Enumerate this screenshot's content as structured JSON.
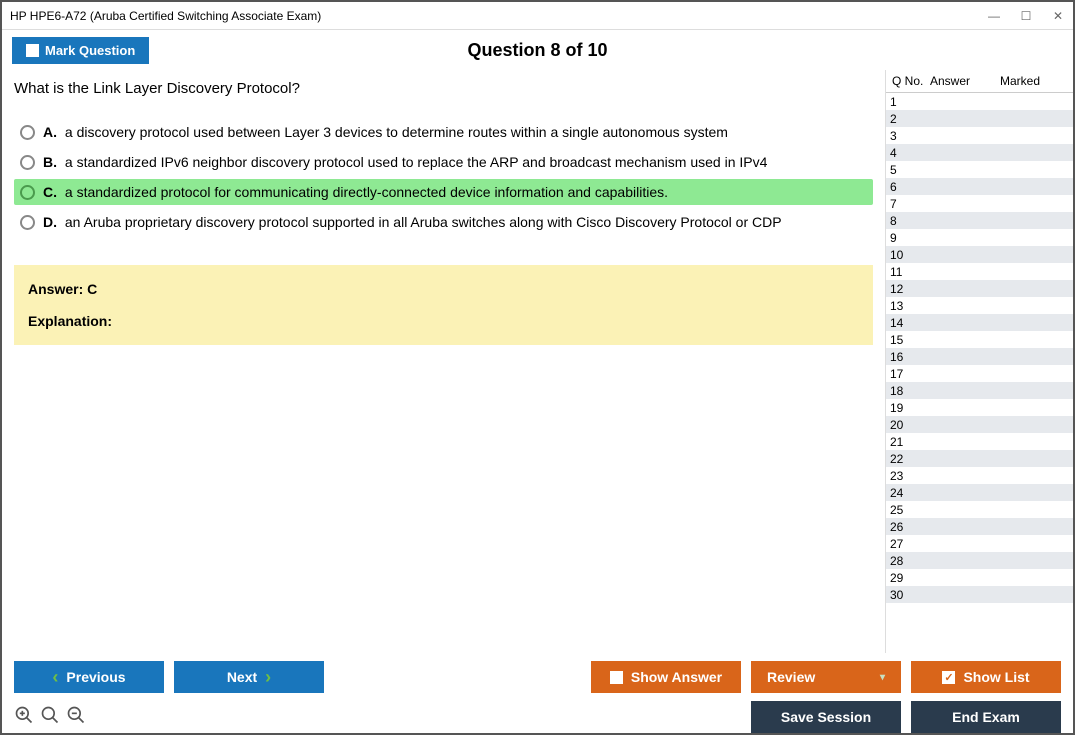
{
  "window": {
    "title": "HP HPE6-A72 (Aruba Certified Switching Associate Exam)"
  },
  "header": {
    "mark_label": "Mark Question",
    "counter": "Question 8 of 10"
  },
  "question": {
    "text": "What is the Link Layer Discovery Protocol?",
    "options": [
      {
        "letter": "A.",
        "text": "a discovery protocol used between Layer 3 devices to determine routes within a single autonomous system",
        "selected": false
      },
      {
        "letter": "B.",
        "text": "a standardized IPv6 neighbor discovery protocol used to replace the ARP and broadcast mechanism used in IPv4",
        "selected": false
      },
      {
        "letter": "C.",
        "text": "a standardized protocol for communicating directly-connected device information and capabilities.",
        "selected": true
      },
      {
        "letter": "D.",
        "text": "an Aruba proprietary discovery protocol supported in all Aruba switches along with Cisco Discovery Protocol or CDP",
        "selected": false
      }
    ]
  },
  "answer": {
    "line": "Answer: C",
    "explanation_label": "Explanation:"
  },
  "sidebar": {
    "col_qno": "Q No.",
    "col_answer": "Answer",
    "col_marked": "Marked",
    "rows": [
      "1",
      "2",
      "3",
      "4",
      "5",
      "6",
      "7",
      "8",
      "9",
      "10",
      "11",
      "12",
      "13",
      "14",
      "15",
      "16",
      "17",
      "18",
      "19",
      "20",
      "21",
      "22",
      "23",
      "24",
      "25",
      "26",
      "27",
      "28",
      "29",
      "30"
    ]
  },
  "buttons": {
    "previous": "Previous",
    "next": "Next",
    "show_answer": "Show Answer",
    "review": "Review",
    "show_list": "Show List",
    "save_session": "Save Session",
    "end_exam": "End Exam"
  }
}
